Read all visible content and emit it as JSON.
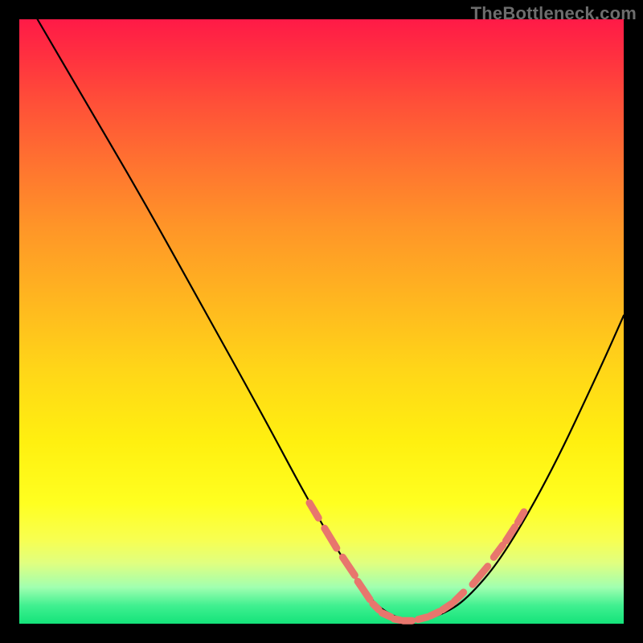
{
  "watermark": {
    "text": "TheBottleneck.com"
  },
  "colors": {
    "page_bg": "#000000",
    "gradient_stops": [
      "#ff1a47",
      "#ff3040",
      "#ff5038",
      "#ff7330",
      "#ff9428",
      "#ffb520",
      "#ffd618",
      "#fff010",
      "#ffff20",
      "#f8ff50",
      "#e0ff80",
      "#a0ffb0",
      "#40f090",
      "#14e37a"
    ],
    "curve_stroke": "#000000",
    "overlay_stroke": "#e8766d"
  },
  "chart_data": {
    "type": "line",
    "title": "",
    "xlabel": "",
    "ylabel": "",
    "xlim": [
      0,
      100
    ],
    "ylim": [
      0,
      100
    ],
    "grid": false,
    "legend": false,
    "series": [
      {
        "name": "bottleneck-curve",
        "x": [
          3,
          10,
          20,
          30,
          40,
          48,
          54,
          58,
          62,
          66,
          70,
          74,
          80,
          88,
          96,
          100
        ],
        "y": [
          100,
          88,
          71,
          53,
          35,
          20,
          10,
          4,
          1,
          0.5,
          1.5,
          4,
          11,
          25,
          42,
          51
        ]
      }
    ],
    "overlay_segments": {
      "name": "highlight-dashes",
      "description": "short coral dash segments overlaid on the curve near its minimum",
      "segments": [
        {
          "x": [
            48,
            49.5
          ],
          "y": [
            20,
            17.5
          ]
        },
        {
          "x": [
            50.5,
            52.5
          ],
          "y": [
            15.8,
            12.5
          ]
        },
        {
          "x": [
            53.5,
            55.5
          ],
          "y": [
            11,
            8
          ]
        },
        {
          "x": [
            56,
            58
          ],
          "y": [
            7,
            4
          ]
        },
        {
          "x": [
            58.5,
            59.5
          ],
          "y": [
            3.3,
            2.3
          ]
        },
        {
          "x": [
            60,
            61.5
          ],
          "y": [
            1.8,
            1.1
          ]
        },
        {
          "x": [
            62,
            63
          ],
          "y": [
            0.8,
            0.6
          ]
        },
        {
          "x": [
            63.5,
            65
          ],
          "y": [
            0.5,
            0.5
          ]
        },
        {
          "x": [
            66,
            67.5
          ],
          "y": [
            0.7,
            1.1
          ]
        },
        {
          "x": [
            68,
            69.5
          ],
          "y": [
            1.3,
            2
          ]
        },
        {
          "x": [
            70,
            71.5
          ],
          "y": [
            2.3,
            3.3
          ]
        },
        {
          "x": [
            72,
            73.5
          ],
          "y": [
            3.7,
            5.2
          ]
        },
        {
          "x": [
            75,
            77.5
          ],
          "y": [
            6.5,
            9.5
          ]
        },
        {
          "x": [
            78.5,
            80
          ],
          "y": [
            11,
            13
          ]
        },
        {
          "x": [
            80.5,
            82
          ],
          "y": [
            13.7,
            16
          ]
        },
        {
          "x": [
            82.5,
            83.5
          ],
          "y": [
            16.8,
            18.5
          ]
        }
      ]
    }
  }
}
